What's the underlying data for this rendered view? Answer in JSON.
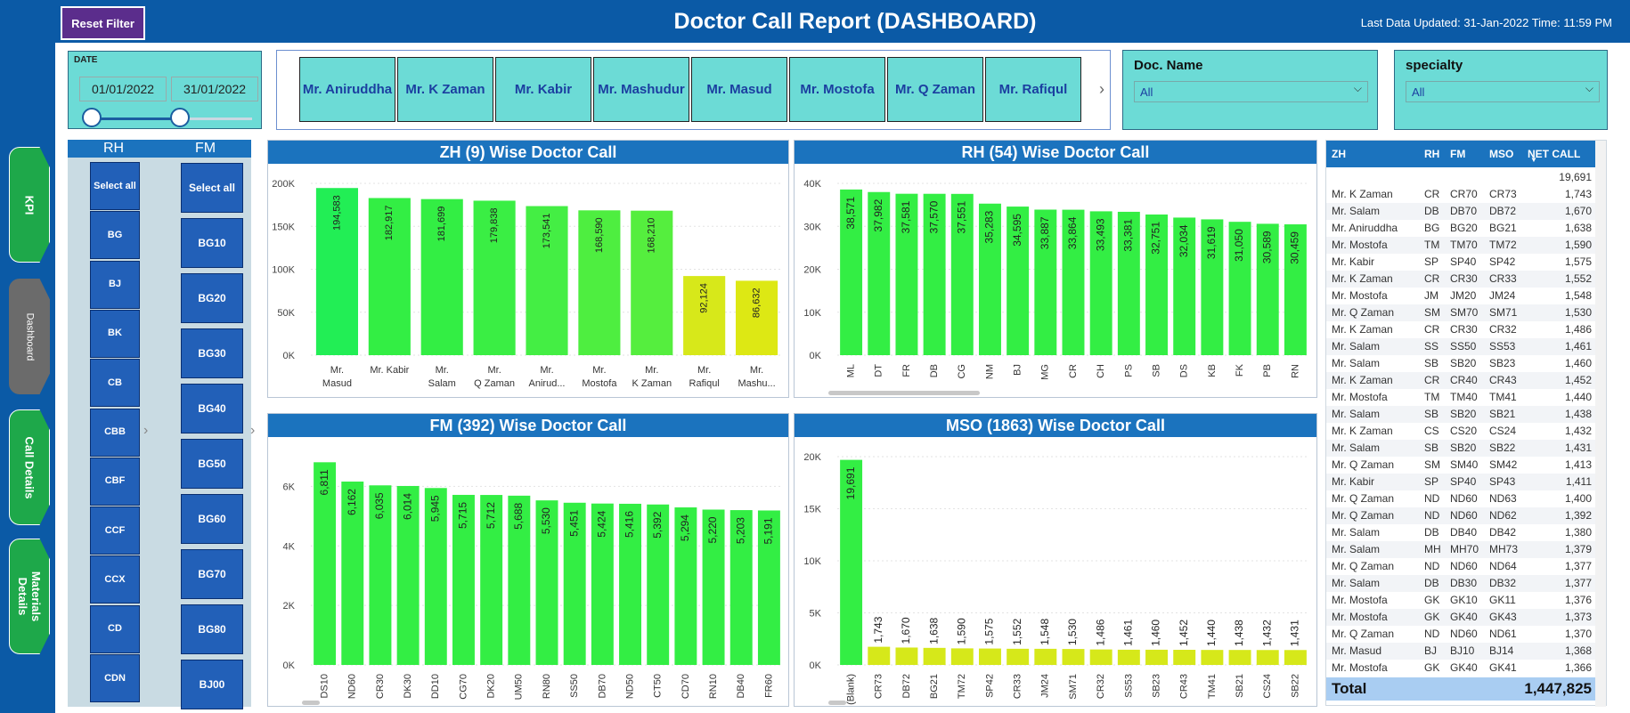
{
  "header": {
    "reset_label": "Reset Filter",
    "title": "Doctor Call Report (DASHBOARD)",
    "updated": "Last Data Updated: 31-Jan-2022 Time: 11:59 PM"
  },
  "nav": [
    {
      "label": "KPI"
    },
    {
      "label": "Dashboard"
    },
    {
      "label": "Call Details"
    },
    {
      "label": "Materials Details"
    }
  ],
  "date": {
    "label": "DATE",
    "start": "01/01/2022",
    "end": "31/01/2022"
  },
  "zh_buttons": [
    "Mr. Aniruddha",
    "Mr. K Zaman",
    "Mr. Kabir",
    "Mr. Mashudur",
    "Mr. Masud",
    "Mr. Mostofa",
    "Mr. Q Zaman",
    "Mr. Rafiqul"
  ],
  "docname": {
    "label": "Doc. Name",
    "value": "All"
  },
  "specialty": {
    "label": "specialty",
    "value": "All"
  },
  "rh": {
    "header": "RH",
    "items": [
      "Select all",
      "BG",
      "BJ",
      "BK",
      "CB",
      "CBB",
      "CBF",
      "CCF",
      "CCX",
      "CD",
      "CDN"
    ]
  },
  "fm": {
    "header": "FM",
    "items": [
      "Select all",
      "BG10",
      "BG20",
      "BG30",
      "BG40",
      "BG50",
      "BG60",
      "BG70",
      "BG80",
      "BJ00"
    ]
  },
  "chart_data": [
    {
      "type": "bar",
      "title": "ZH (9) Wise Doctor Call",
      "categories": [
        "Mr. Masud",
        "Mr. Kabir",
        "Mr. Salam",
        "Mr. Q Zaman",
        "Mr. Anirud...",
        "Mr. Mostofa",
        "Mr. K Zaman",
        "Mr. Rafiqul",
        "Mr. Mashu..."
      ],
      "values": [
        194583,
        182917,
        181699,
        179838,
        173541,
        168590,
        168210,
        92124,
        86632
      ],
      "ylim": [
        0,
        200000
      ],
      "yticks": [
        "0K",
        "50K",
        "100K",
        "150K",
        "200K"
      ],
      "labels": [
        "194,583",
        "182,917",
        "181,699",
        "179,838",
        "173,541",
        "168,590",
        "168,210",
        "92,124",
        "86,632"
      ],
      "colors": [
        "#22ee55",
        "#33ee44",
        "#33ee44",
        "#3aee44",
        "#44ee44",
        "#4eee40",
        "#55ee3e",
        "#d7e81a",
        "#dde814"
      ]
    },
    {
      "type": "bar",
      "title": "RH (54) Wise Doctor Call",
      "categories": [
        "ML",
        "DT",
        "FR",
        "DB",
        "CG",
        "NM",
        "BJ",
        "MG",
        "CR",
        "CH",
        "PS",
        "SB",
        "DS",
        "KB",
        "FK",
        "PB",
        "RN"
      ],
      "values": [
        38571,
        37982,
        37581,
        37570,
        37551,
        35283,
        34595,
        33887,
        33864,
        33493,
        33381,
        32751,
        32034,
        31619,
        31050,
        30589,
        30459
      ],
      "ylim": [
        0,
        40000
      ],
      "yticks": [
        "0K",
        "10K",
        "20K",
        "30K",
        "40K"
      ],
      "labels": [
        "38,571",
        "37,982",
        "37,581",
        "37,570",
        "37,551",
        "35,283",
        "34,595",
        "33,887",
        "33,864",
        "33,493",
        "33,381",
        "32,751",
        "32,034",
        "31,619",
        "31,050",
        "30,589",
        "30,459"
      ]
    },
    {
      "type": "bar",
      "title": "FM (392) Wise Doctor Call",
      "categories": [
        "DS10",
        "ND60",
        "CR30",
        "DK30",
        "DD10",
        "CG70",
        "DK20",
        "UM50",
        "RN80",
        "SS50",
        "DB70",
        "ND50",
        "CT50",
        "CD70",
        "RN10",
        "DB40",
        "FR60"
      ],
      "values": [
        6811,
        6162,
        6035,
        6014,
        5945,
        5715,
        5712,
        5688,
        5530,
        5451,
        5424,
        5416,
        5392,
        5294,
        5220,
        5203,
        5191
      ],
      "ylim": [
        0,
        7000
      ],
      "yticks": [
        "0K",
        "2K",
        "4K",
        "6K"
      ],
      "labels": [
        "6,811",
        "6,162",
        "6,035",
        "6,014",
        "5,945",
        "5,715",
        "5,712",
        "5,688",
        "5,530",
        "5,451",
        "5,424",
        "5,416",
        "5,392",
        "5,294",
        "5,220",
        "5,203",
        "5,191"
      ]
    },
    {
      "type": "bar",
      "title": "MSO (1863) Wise Doctor Call",
      "categories": [
        "(Blank)",
        "CR73",
        "DB72",
        "BG21",
        "TM72",
        "SP42",
        "CR33",
        "JM24",
        "SM71",
        "CR32",
        "SS53",
        "SB23",
        "CR43",
        "TM41",
        "SB21",
        "CS24",
        "SB22"
      ],
      "values": [
        19691,
        1743,
        1670,
        1638,
        1590,
        1575,
        1552,
        1548,
        1530,
        1486,
        1461,
        1460,
        1452,
        1440,
        1438,
        1432,
        1431
      ],
      "ylim": [
        0,
        20000
      ],
      "yticks": [
        "0K",
        "5K",
        "10K",
        "15K",
        "20K"
      ],
      "labels": [
        "19,691",
        "1,743",
        "1,670",
        "1,638",
        "1,590",
        "1,575",
        "1,552",
        "1,548",
        "1,530",
        "1,486",
        "1,461",
        "1,460",
        "1,452",
        "1,440",
        "1,438",
        "1,432",
        "1,431"
      ]
    }
  ],
  "table": {
    "headers": [
      "ZH",
      "RH",
      "FM",
      "MSO",
      "NET CALL"
    ],
    "blank_row_total": "19,691",
    "rows": [
      [
        "Mr. K Zaman",
        "CR",
        "CR70",
        "CR73",
        "1,743"
      ],
      [
        "Mr. Salam",
        "DB",
        "DB70",
        "DB72",
        "1,670"
      ],
      [
        "Mr. Aniruddha",
        "BG",
        "BG20",
        "BG21",
        "1,638"
      ],
      [
        "Mr. Mostofa",
        "TM",
        "TM70",
        "TM72",
        "1,590"
      ],
      [
        "Mr. Kabir",
        "SP",
        "SP40",
        "SP42",
        "1,575"
      ],
      [
        "Mr. K Zaman",
        "CR",
        "CR30",
        "CR33",
        "1,552"
      ],
      [
        "Mr. Mostofa",
        "JM",
        "JM20",
        "JM24",
        "1,548"
      ],
      [
        "Mr. Q Zaman",
        "SM",
        "SM70",
        "SM71",
        "1,530"
      ],
      [
        "Mr. K Zaman",
        "CR",
        "CR30",
        "CR32",
        "1,486"
      ],
      [
        "Mr. Salam",
        "SS",
        "SS50",
        "SS53",
        "1,461"
      ],
      [
        "Mr. Salam",
        "SB",
        "SB20",
        "SB23",
        "1,460"
      ],
      [
        "Mr. K Zaman",
        "CR",
        "CR40",
        "CR43",
        "1,452"
      ],
      [
        "Mr. Mostofa",
        "TM",
        "TM40",
        "TM41",
        "1,440"
      ],
      [
        "Mr. Salam",
        "SB",
        "SB20",
        "SB21",
        "1,438"
      ],
      [
        "Mr. K Zaman",
        "CS",
        "CS20",
        "CS24",
        "1,432"
      ],
      [
        "Mr. Salam",
        "SB",
        "SB20",
        "SB22",
        "1,431"
      ],
      [
        "Mr. Q Zaman",
        "SM",
        "SM40",
        "SM42",
        "1,413"
      ],
      [
        "Mr. Kabir",
        "SP",
        "SP40",
        "SP43",
        "1,411"
      ],
      [
        "Mr. Q Zaman",
        "ND",
        "ND60",
        "ND63",
        "1,400"
      ],
      [
        "Mr. Q Zaman",
        "ND",
        "ND60",
        "ND62",
        "1,392"
      ],
      [
        "Mr. Salam",
        "DB",
        "DB40",
        "DB42",
        "1,380"
      ],
      [
        "Mr. Salam",
        "MH",
        "MH70",
        "MH73",
        "1,379"
      ],
      [
        "Mr. Q Zaman",
        "ND",
        "ND60",
        "ND64",
        "1,377"
      ],
      [
        "Mr. Salam",
        "DB",
        "DB30",
        "DB32",
        "1,377"
      ],
      [
        "Mr. Mostofa",
        "GK",
        "GK10",
        "GK11",
        "1,376"
      ],
      [
        "Mr. Mostofa",
        "GK",
        "GK40",
        "GK43",
        "1,373"
      ],
      [
        "Mr. Q Zaman",
        "ND",
        "ND60",
        "ND61",
        "1,370"
      ],
      [
        "Mr. Masud",
        "BJ",
        "BJ10",
        "BJ14",
        "1,368"
      ],
      [
        "Mr. Mostofa",
        "GK",
        "GK40",
        "GK41",
        "1,366"
      ]
    ],
    "total_label": "Total",
    "total_value": "1,447,825"
  }
}
